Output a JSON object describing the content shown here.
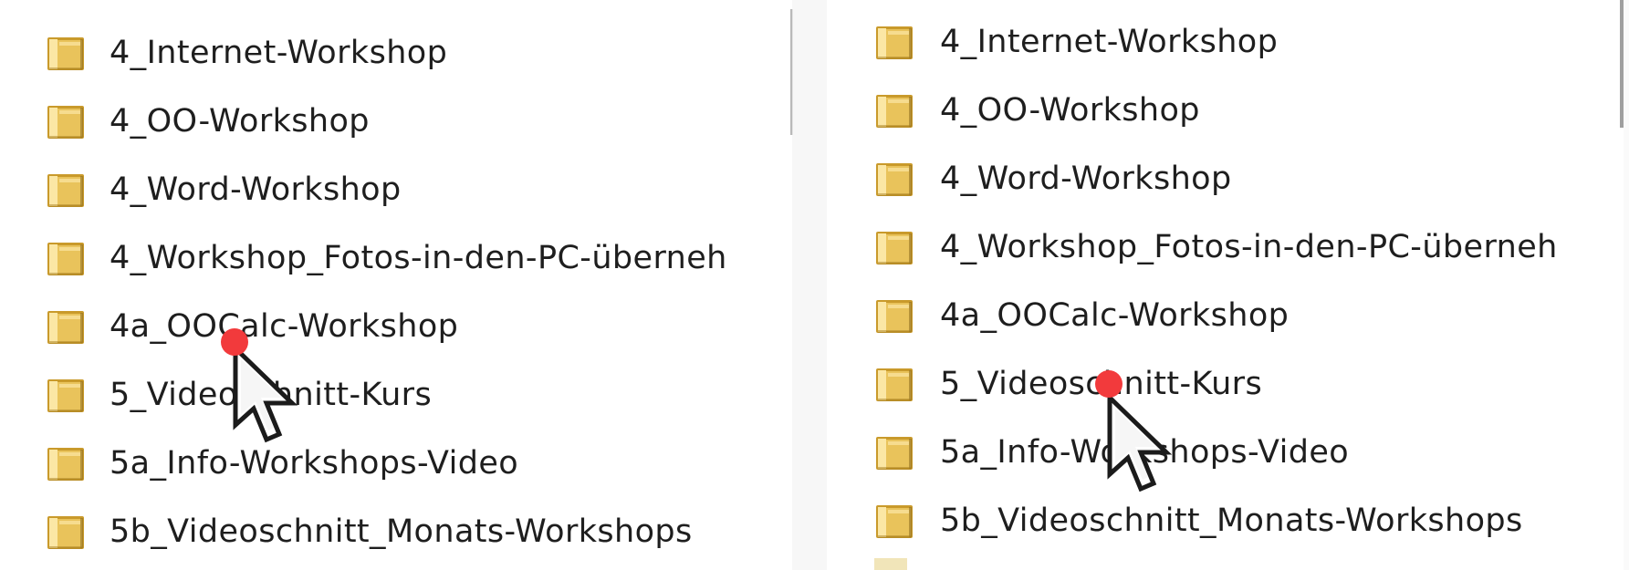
{
  "colors": {
    "folder_body": "#e9c35b",
    "folder_light": "#fbe7a5",
    "folder_dark": "#c99a2b",
    "label_text": "#1e1e1e",
    "click_dot": "#f23a3c",
    "divider": "#b9b9b9"
  },
  "icons": {
    "folder": "folder-icon",
    "pointer": "mouse-pointer-icon",
    "click_marker": "click-dot"
  },
  "panels": [
    {
      "name": "before-click",
      "rows": [
        {
          "label": "4_Internet-Workshop"
        },
        {
          "label": "4_OO-Workshop"
        },
        {
          "label": "4_Word-Workshop"
        },
        {
          "label": "4_Workshop_Fotos-in-den-PC-überneh"
        },
        {
          "label": "4a_OOCalc-Workshop"
        },
        {
          "label": "5_Videoschnitt-Kurs"
        },
        {
          "label": "5a_Info-Workshops-Video"
        },
        {
          "label": "5b_Videoschnitt_Monats-Workshops"
        }
      ]
    },
    {
      "name": "after-click",
      "rows": [
        {
          "label": "4_Internet-Workshop"
        },
        {
          "label": "4_OO-Workshop"
        },
        {
          "label": "4_Word-Workshop"
        },
        {
          "label": "4_Workshop_Fotos-in-den-PC-überneh"
        },
        {
          "label": "4a_OOCalc-Workshop"
        },
        {
          "label": "5_Videoschnitt-Kurs"
        },
        {
          "label": "5a_Info-Workshops-Video"
        },
        {
          "label": "5b_Videoschnitt_Monats-Workshops"
        }
      ]
    }
  ]
}
